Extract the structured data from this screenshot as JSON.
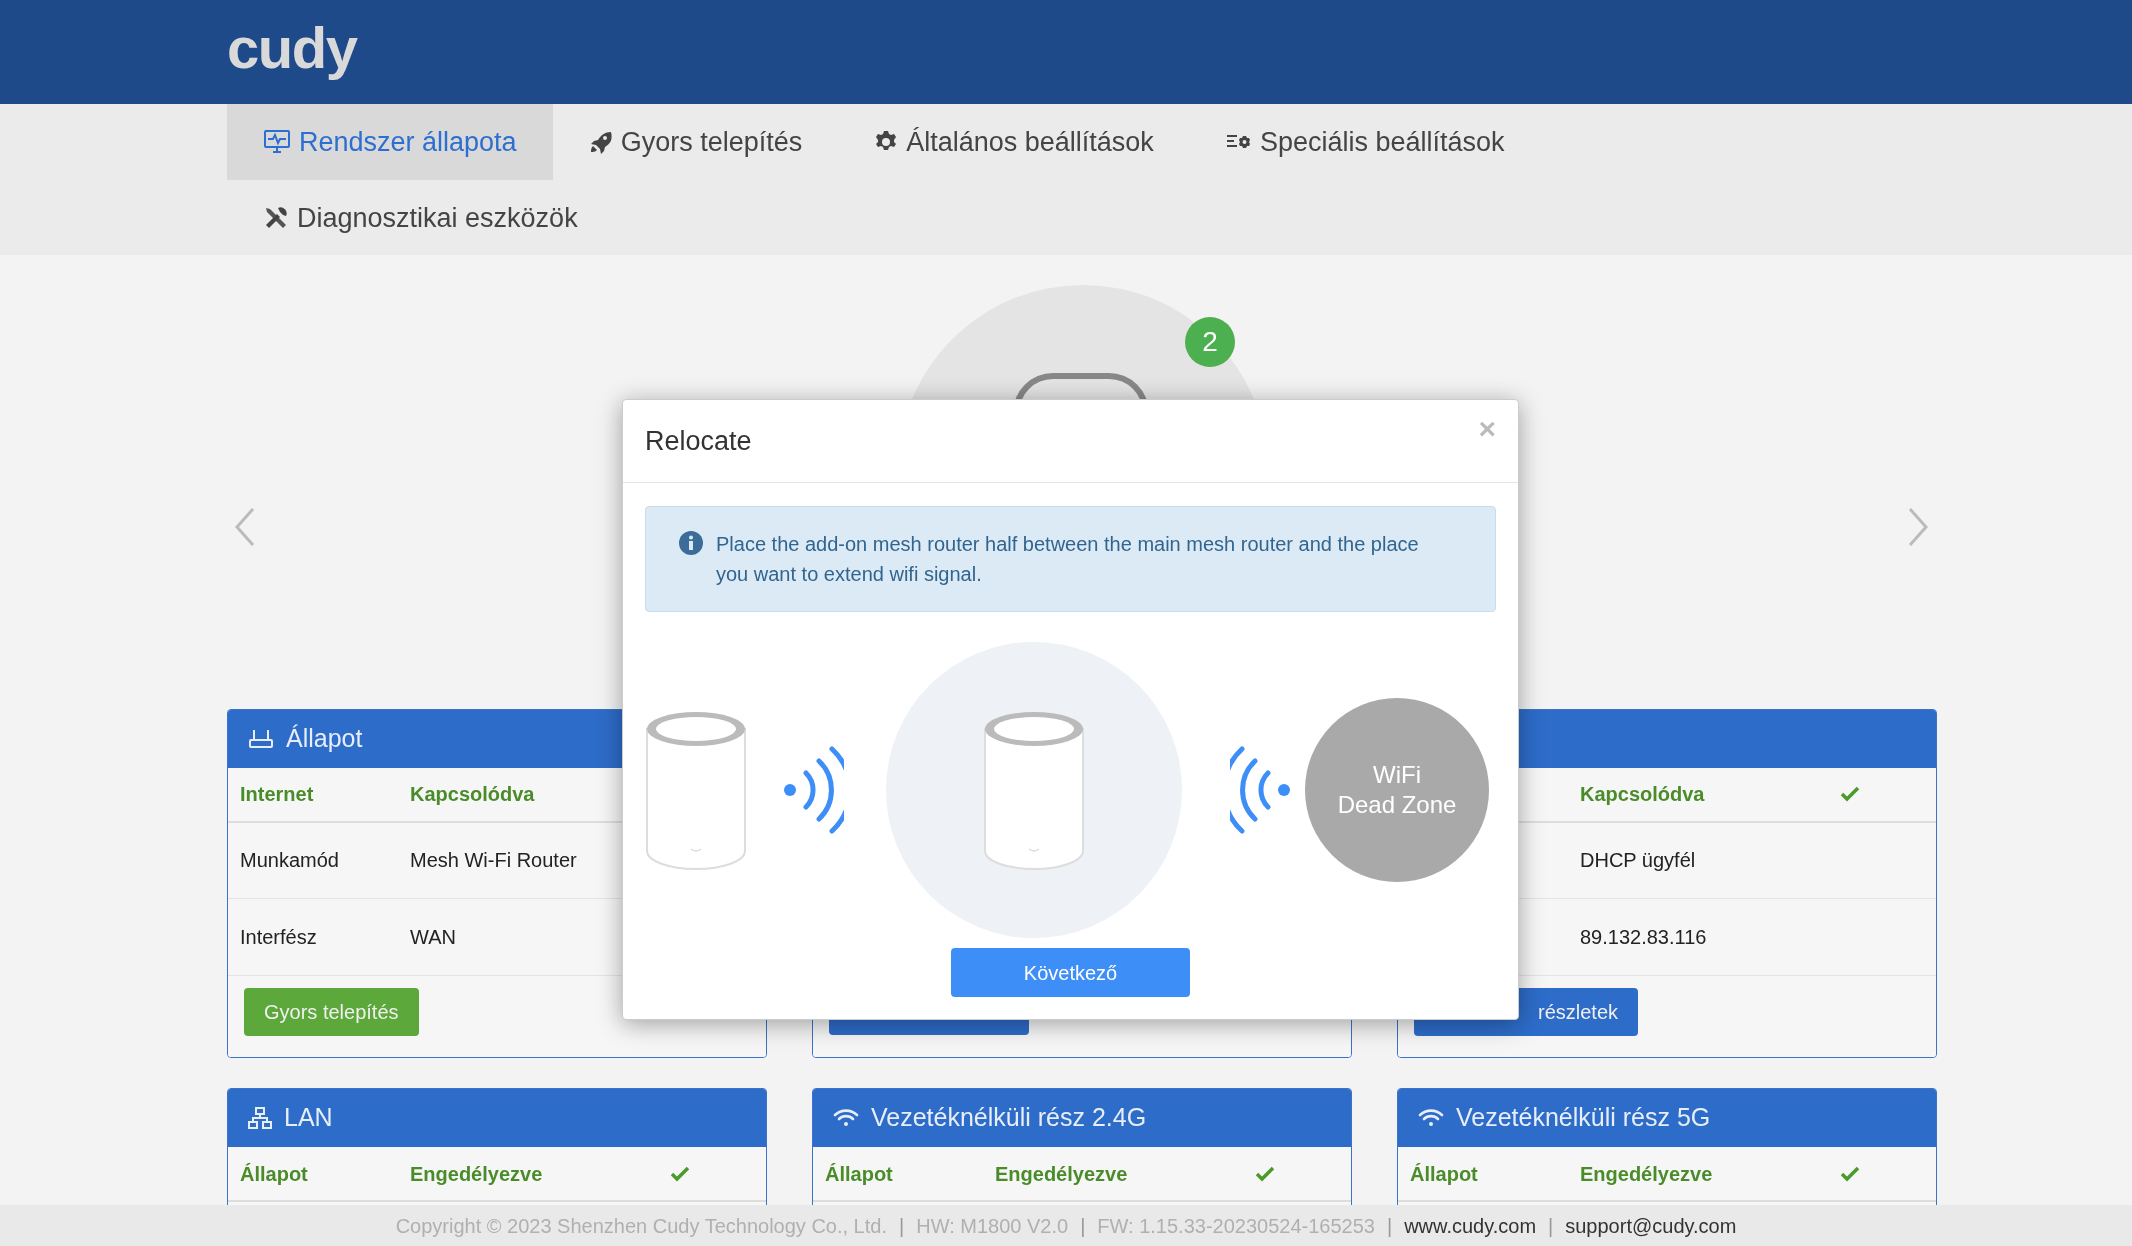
{
  "header": {
    "logo": "cudy"
  },
  "nav": {
    "tabs": [
      {
        "label": "Rendszer állapota",
        "kind": "monitor",
        "selected": true
      },
      {
        "label": "Gyors telepítés",
        "kind": "rocket",
        "selected": false
      },
      {
        "label": "Általános beállítások",
        "kind": "gear",
        "selected": false
      },
      {
        "label": "Speciális beállítások",
        "kind": "sliders",
        "selected": false
      },
      {
        "label": "Diagnosztikai eszközök",
        "kind": "tools",
        "selected": false
      }
    ]
  },
  "carousel": {
    "badge": "2"
  },
  "panels": [
    {
      "title": "Állapot",
      "kind": "router",
      "rows": [
        {
          "kind": "status",
          "label": "Internet",
          "value": "Kapcsolódva"
        },
        {
          "kind": "info",
          "label": "Munkamód",
          "value": "Mesh Wi-Fi Router"
        },
        {
          "kind": "info",
          "label": "Interfész",
          "value": "WAN"
        }
      ],
      "button": {
        "kind": "success",
        "label": "Gyors telepítés"
      }
    },
    {
      "button": {
        "kind": "primary"
      }
    },
    {
      "rows": [
        {
          "kind": "status",
          "value": "Kapcsolódva",
          "ok": true
        },
        {
          "kind": "info",
          "value": "DHCP ügyfél"
        },
        {
          "kind": "info",
          "value": "89.132.83.116"
        }
      ],
      "button": {
        "kind": "primary",
        "label": "részletek"
      }
    },
    {
      "title": "LAN",
      "kind": "network",
      "rows": [
        {
          "kind": "status",
          "label": "Állapot",
          "value": "Engedélyezve",
          "ok": true
        }
      ]
    },
    {
      "title": "Vezetéknélküli rész 2.4G",
      "kind": "wifi",
      "rows": [
        {
          "kind": "status",
          "label": "Állapot",
          "value": "Engedélyezve",
          "ok": true
        }
      ]
    },
    {
      "title": "Vezetéknélküli rész 5G",
      "kind": "wifi",
      "rows": [
        {
          "kind": "status",
          "label": "Állapot",
          "value": "Engedélyezve",
          "ok": true
        }
      ]
    }
  ],
  "footer": [
    {
      "kind": "text",
      "text": "Copyright © 2023 Shenzhen Cudy Technology Co., Ltd."
    },
    {
      "kind": "separator",
      "text": "|"
    },
    {
      "kind": "text",
      "text": "HW: M1800 V2.0"
    },
    {
      "kind": "separator",
      "text": "|"
    },
    {
      "kind": "text",
      "text": "FW: 1.15.33-20230524-165253"
    },
    {
      "kind": "separator",
      "text": "|"
    },
    {
      "kind": "link",
      "text": "www.cudy.com"
    },
    {
      "kind": "separator",
      "text": "|"
    },
    {
      "kind": "link",
      "text": "support@cudy.com"
    }
  ],
  "modal": {
    "title": "Relocate",
    "close": "×",
    "alert": "Place the add-on mesh router half between the main mesh router and the place you want to extend wifi signal.",
    "dead_zone": [
      "WiFi",
      "Dead Zone"
    ],
    "button": "Következő"
  }
}
